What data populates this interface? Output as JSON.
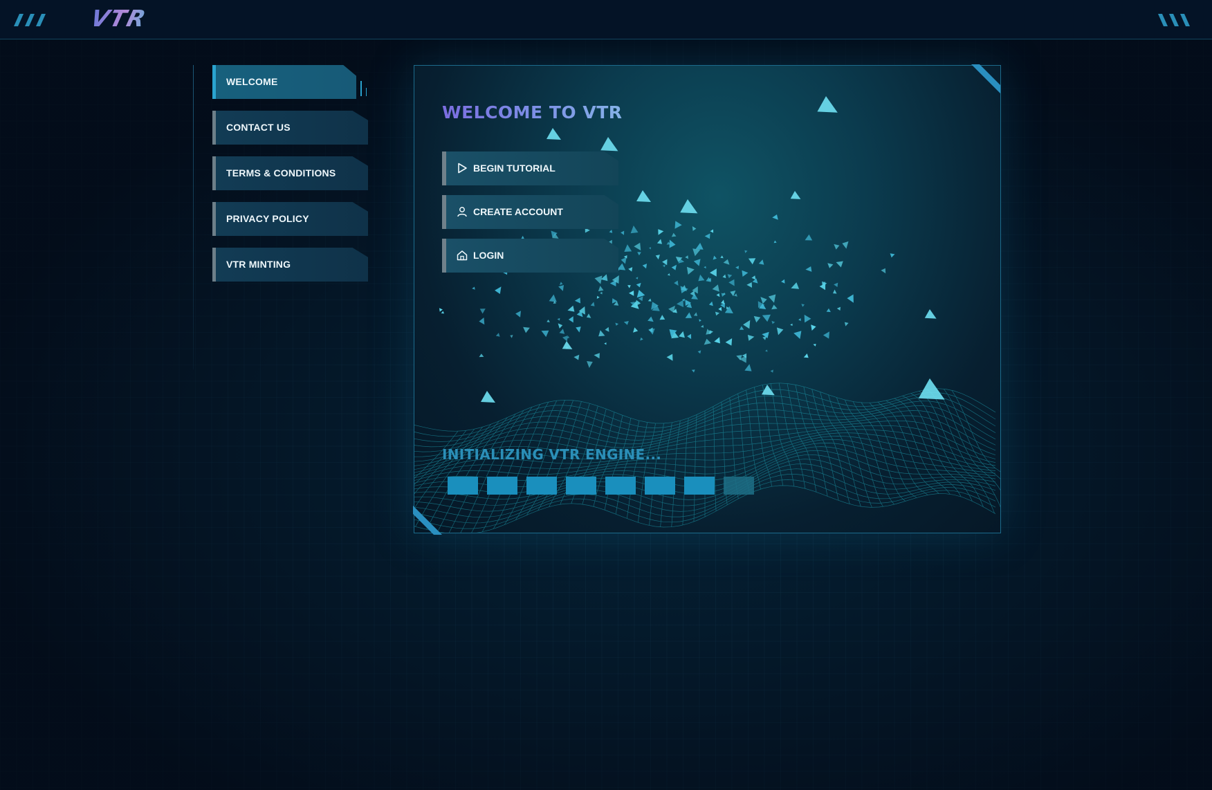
{
  "app": {
    "logo_text": "VTR"
  },
  "nav": {
    "items": [
      {
        "label": "WELCOME",
        "active": true
      },
      {
        "label": "CONTACT US",
        "active": false
      },
      {
        "label": "TERMS & CONDITIONS",
        "active": false
      },
      {
        "label": "PRIVACY POLICY",
        "active": false
      },
      {
        "label": "VTR MINTING",
        "active": false
      }
    ]
  },
  "panel": {
    "title": "WELCOME TO VTR",
    "actions": [
      {
        "label": "BEGIN TUTORIAL",
        "icon": "play-icon"
      },
      {
        "label": "CREATE ACCOUNT",
        "icon": "user-icon"
      },
      {
        "label": "LOGIN",
        "icon": "home-icon"
      }
    ],
    "status_text": "INITIALIZING VTR ENGINE...",
    "progress": {
      "filled_segments": 7,
      "total_segments": 8
    }
  },
  "colors": {
    "background": "#03101f",
    "accent": "#2aa3cf",
    "title_gradient_start": "#7b6de0",
    "progress_fill": "#1a8fbd"
  }
}
